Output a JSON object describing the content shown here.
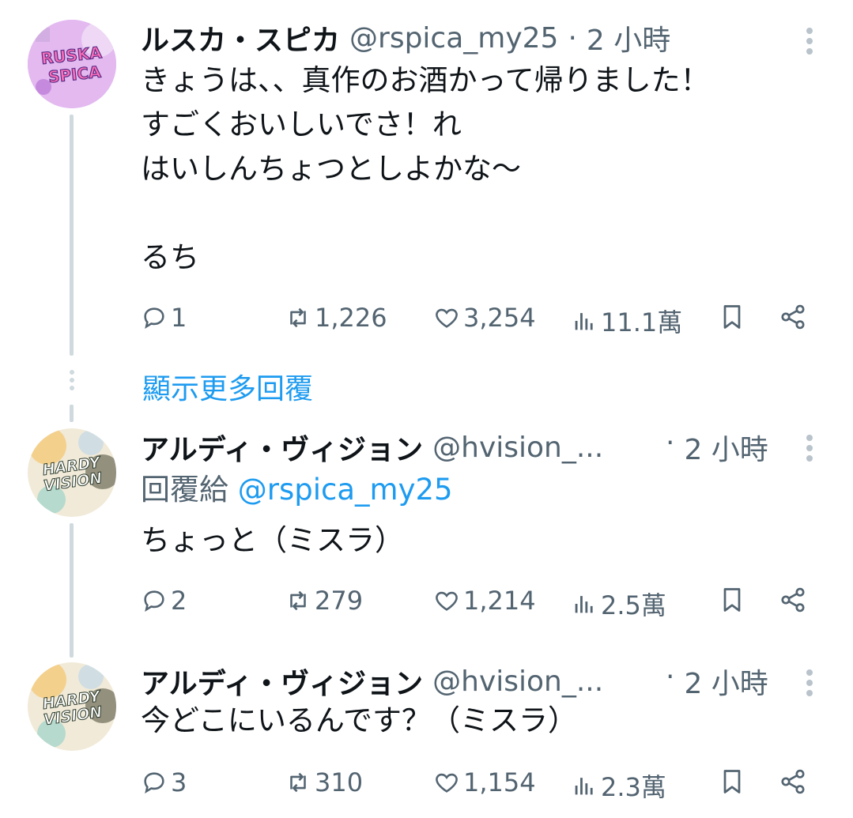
{
  "tweets": [
    {
      "name": "ルスカ・スピカ",
      "handle": "@rspica_my25",
      "separator": "·",
      "time": "2 小時",
      "avatar": {
        "text_top": "RUSKA",
        "text_bottom": "SPICA",
        "bg": "#d8a9e8"
      },
      "lines": [
        "きょうは、、真作のお酒かって帰りました！",
        "すごくおいしいでさ！れ",
        "はいしんちょつとしよかな〜",
        "",
        "るち"
      ],
      "replies": "1",
      "retweets": "1,226",
      "likes": "3,254",
      "views": "11.1萬"
    },
    {
      "name": "アルディ・ヴィジョン",
      "handle": "@hvision_...",
      "separator": "·",
      "time": "2 小時",
      "avatar": {
        "text_top": "HARDY",
        "text_bottom": "VISION",
        "bg": "#efe7d2"
      },
      "reply_prefix": "回覆給",
      "reply_to": "@rspica_my25",
      "lines": [
        "ちょっと（ミスラ）"
      ],
      "replies": "2",
      "retweets": "279",
      "likes": "1,214",
      "views": "2.5萬"
    },
    {
      "name": "アルディ・ヴィジョン",
      "handle": "@hvision_...",
      "separator": "·",
      "time": "2 小時",
      "avatar": {
        "text_top": "HARDY",
        "text_bottom": "VISION",
        "bg": "#efe7d2"
      },
      "lines": [
        "今どこにいるんです？（ミスラ）"
      ],
      "replies": "3",
      "retweets": "310",
      "likes": "1,154",
      "views": "2.3萬"
    }
  ],
  "show_more_replies": "顯示更多回覆",
  "colors": {
    "text": "#0f1419",
    "muted": "#536471",
    "link": "#1d9bf0",
    "thread": "#cfd9de"
  }
}
